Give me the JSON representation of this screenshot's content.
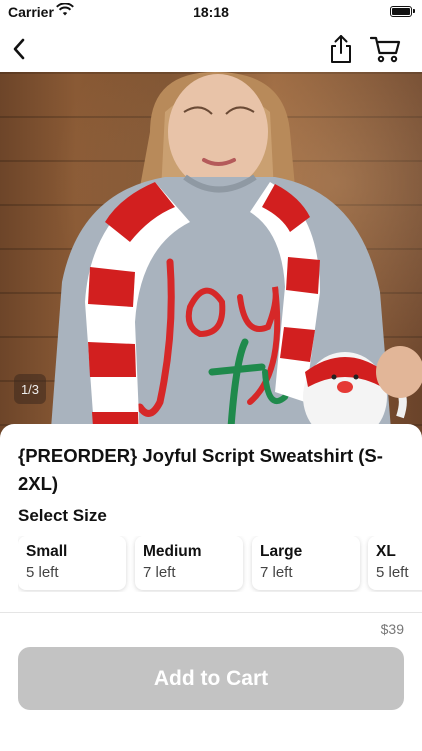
{
  "status_bar": {
    "carrier": "Carrier",
    "time": "18:18"
  },
  "nav": {
    "back_icon": "chevron-left-icon",
    "share_icon": "share-icon",
    "cart_icon": "cart-icon"
  },
  "gallery": {
    "counter": "1/3"
  },
  "product": {
    "title": "{PREORDER} Joyful Script Sweatshirt (S-2XL)",
    "select_size_label": "Select Size",
    "sizes": [
      {
        "name": "Small",
        "stock": "5 left"
      },
      {
        "name": "Medium",
        "stock": "7 left"
      },
      {
        "name": "Large",
        "stock": "7 left"
      },
      {
        "name": "XL",
        "stock": "5 left"
      }
    ],
    "price": "$39"
  },
  "footer": {
    "add_to_cart_label": "Add to Cart"
  },
  "colors": {
    "button_disabled": "#c3c3c3",
    "text_primary": "#111111",
    "price_text": "#777777"
  }
}
